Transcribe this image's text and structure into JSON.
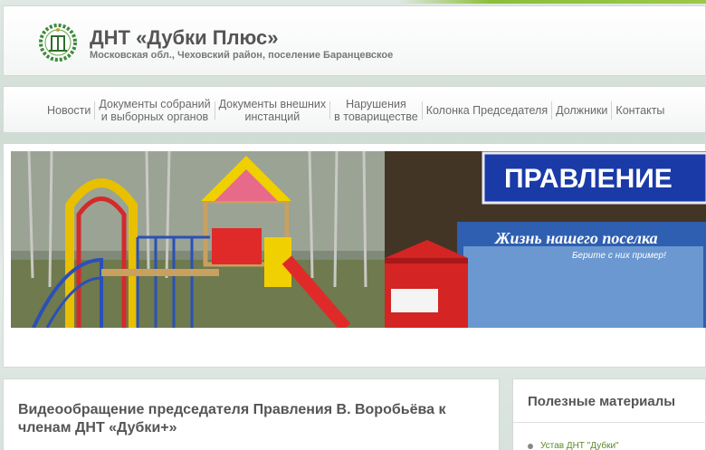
{
  "header": {
    "title": "ДНТ «Дубки Плюс»",
    "subtitle": "Московская обл., Чеховский район, поселение Баранцевское",
    "logo_icon": "oak-wreath-emblem-icon"
  },
  "nav": {
    "items": [
      {
        "line1": "Новости",
        "line2": ""
      },
      {
        "line1": "Документы собраний",
        "line2": "и выборных органов"
      },
      {
        "line1": "Документы внешних",
        "line2": "инстанций"
      },
      {
        "line1": "Нарушения",
        "line2": "в товариществе"
      },
      {
        "line1": "Колонка Председателя",
        "line2": ""
      },
      {
        "line1": "Должники",
        "line2": ""
      },
      {
        "line1": "Контакты",
        "line2": ""
      }
    ]
  },
  "banner": {
    "board_sign": "ПРАВЛЕНИЕ",
    "poster_title": "Жизнь нашего поселка",
    "poster_sub": "Берите с них пример!"
  },
  "article": {
    "title": "Видеообращение председателя Правления В. Воробьёва к членам ДНТ «Дубки+»"
  },
  "sidebar": {
    "title": "Полезные материалы",
    "link": "Устав ДНТ \"Дубки\""
  },
  "colors": {
    "accent_green": "#8cbe3c",
    "text_gray": "#555555",
    "link_green": "#5a8a2a"
  }
}
